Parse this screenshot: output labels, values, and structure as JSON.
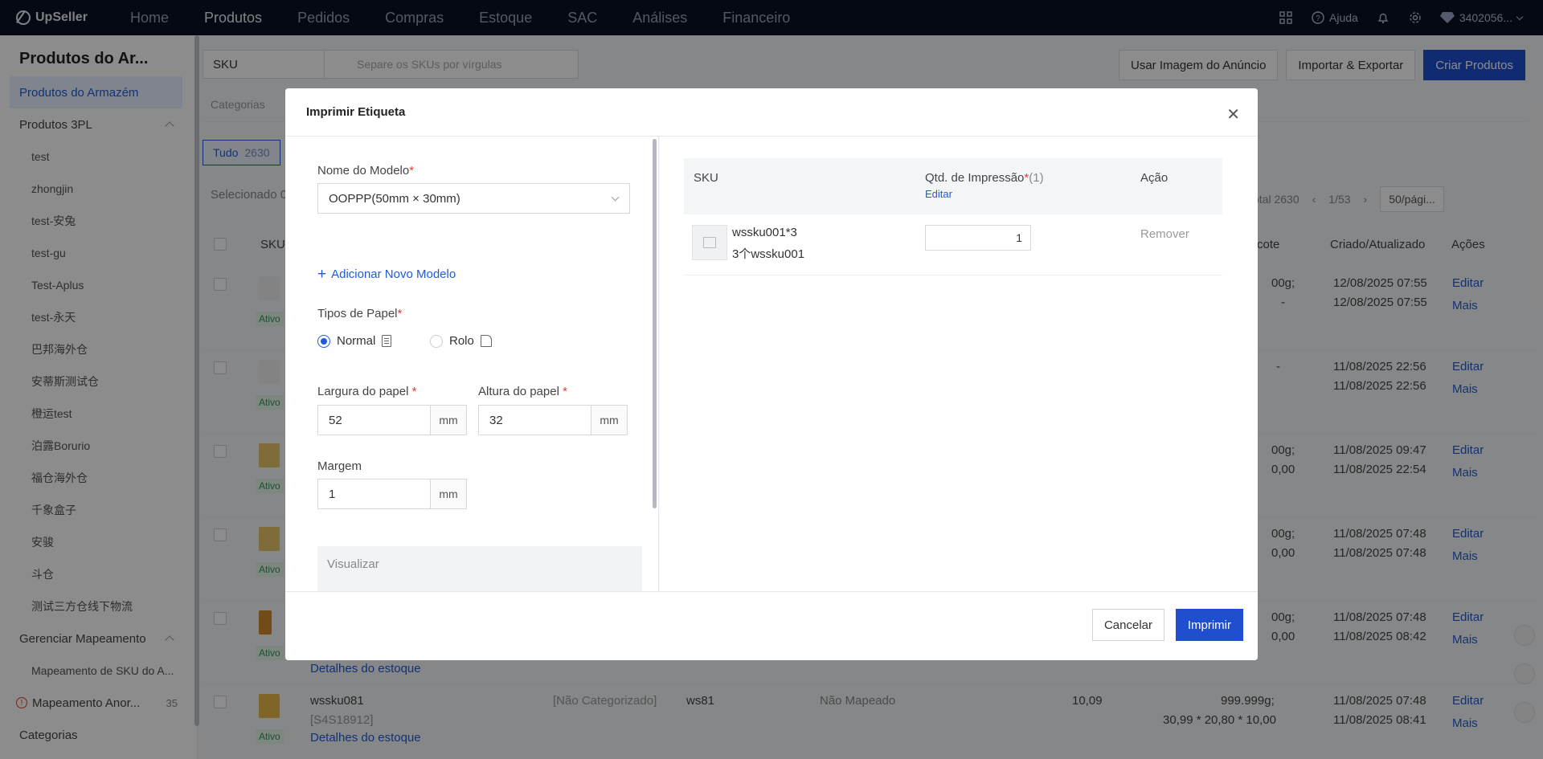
{
  "topbar": {
    "brand": "UpSeller",
    "nav": [
      "Home",
      "Produtos",
      "Pedidos",
      "Compras",
      "Estoque",
      "SAC",
      "Análises",
      "Financeiro"
    ],
    "active_nav": "Produtos",
    "help": "Ajuda",
    "account": "3402056..."
  },
  "sidebar": {
    "title": "Produtos do Ar...",
    "active_item": "Produtos do Armazém",
    "group_3pl": "Produtos 3PL",
    "items_3pl": [
      "test",
      "zhongjin",
      "test-安兔",
      "test-gu",
      "Test-Aplus",
      "test-永天",
      "巴邦海外仓",
      "安蒂斯测试仓",
      "橙运test",
      "泊露Borurio",
      "福仓海外仓",
      "千象盒子",
      "安骏",
      "斗仓",
      "测试三方仓线下物流"
    ],
    "group_map": "Gerenciar Mapeamento",
    "map_item1": "Mapeamento de SKU do A...",
    "map_item2": "Mapeamento Anor...",
    "map_item2_count": "35",
    "categories": "Categorias"
  },
  "main": {
    "sku_select": "SKU",
    "search_placeholder": "Separe os SKUs por vírgulas",
    "btn_use_image": "Usar Imagem do Anúncio",
    "btn_import_export": "Importar & Exportar",
    "btn_create": "Criar Produtos",
    "filter_categories": "Categorias",
    "tab_all": "Tudo",
    "tab_all_count": "2630",
    "selected": "Selecionado 0",
    "total": "Total 2630",
    "page": "1/53",
    "per_page": "50/pági...",
    "col_sku": "SKU",
    "col_lote": "cote",
    "col_created": "Criado/Atualizado",
    "col_actions": "Ações",
    "edit": "Editar",
    "more": "Mais",
    "status_active": "Ativo",
    "rows": [
      {
        "weight": "00g;",
        "dims": "-",
        "created": "12/08/2025 07:55",
        "updated": "12/08/2025 07:55"
      },
      {
        "weight": "-",
        "dims": "",
        "created": "11/08/2025 22:56",
        "updated": "11/08/2025 22:56"
      },
      {
        "weight": "00g;",
        "dims": "0,00",
        "created": "11/08/2025 09:47",
        "updated": "11/08/2025 22:54"
      },
      {
        "weight": "00g;",
        "dims": "0,00",
        "created": "11/08/2025 07:48",
        "updated": "11/08/2025 07:48"
      },
      {
        "weight": "00g;",
        "dims": "0,00",
        "created": "11/08/2025 07:48",
        "updated": "11/08/2025 08:42"
      }
    ],
    "stock_details": "Detalhes do estoque",
    "last_row": {
      "sku": "wssku081",
      "code": "[S4S18912]",
      "category": "[Não Categorizado]",
      "ws": "ws81",
      "mapping": "Não Mapeado",
      "price": "10,09",
      "weight": "999.999g;",
      "dims": "30,99 * 20,80 * 10,00",
      "created": "11/08/2025 07:48",
      "updated": "11/08/2025 08:41"
    }
  },
  "modal": {
    "title": "Imprimir Etiqueta",
    "model_label": "Nome do Modelo",
    "model_value": "OOPPP(50mm × 30mm)",
    "add_model": "Adicionar Novo Modelo",
    "paper_types_label": "Tipos de Papel",
    "paper_normal": "Normal",
    "paper_roll": "Rolo",
    "width_label": "Largura do papel",
    "width_value": "52",
    "height_label": "Altura do papel",
    "height_value": "32",
    "margin_label": "Margem",
    "margin_value": "1",
    "unit": "mm",
    "preview_label": "Visualizar",
    "tbl_col_sku": "SKU",
    "tbl_col_qty": "Qtd. de Impressão",
    "tbl_col_qty_count": "(1)",
    "tbl_col_qty_edit": "Editar",
    "tbl_col_action": "Ação",
    "item_sku": "wssku001*3",
    "item_name": "3个wssku001",
    "item_qty": "1",
    "item_remove": "Remover",
    "btn_cancel": "Cancelar",
    "btn_print": "Imprimir"
  }
}
